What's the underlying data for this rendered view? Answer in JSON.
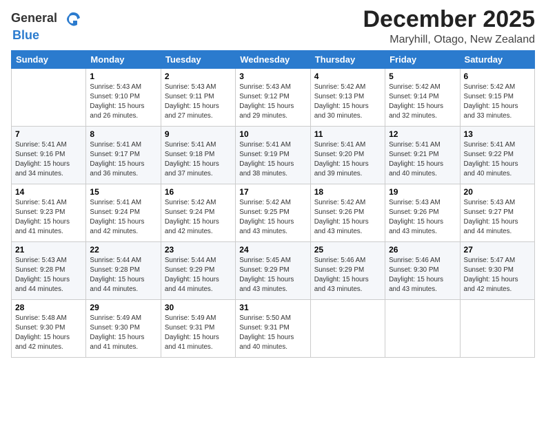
{
  "header": {
    "logo_general": "General",
    "logo_blue": "Blue",
    "month": "December 2025",
    "location": "Maryhill, Otago, New Zealand"
  },
  "weekdays": [
    "Sunday",
    "Monday",
    "Tuesday",
    "Wednesday",
    "Thursday",
    "Friday",
    "Saturday"
  ],
  "weeks": [
    [
      {
        "day": "",
        "info": ""
      },
      {
        "day": "1",
        "info": "Sunrise: 5:43 AM\nSunset: 9:10 PM\nDaylight: 15 hours\nand 26 minutes."
      },
      {
        "day": "2",
        "info": "Sunrise: 5:43 AM\nSunset: 9:11 PM\nDaylight: 15 hours\nand 27 minutes."
      },
      {
        "day": "3",
        "info": "Sunrise: 5:43 AM\nSunset: 9:12 PM\nDaylight: 15 hours\nand 29 minutes."
      },
      {
        "day": "4",
        "info": "Sunrise: 5:42 AM\nSunset: 9:13 PM\nDaylight: 15 hours\nand 30 minutes."
      },
      {
        "day": "5",
        "info": "Sunrise: 5:42 AM\nSunset: 9:14 PM\nDaylight: 15 hours\nand 32 minutes."
      },
      {
        "day": "6",
        "info": "Sunrise: 5:42 AM\nSunset: 9:15 PM\nDaylight: 15 hours\nand 33 minutes."
      }
    ],
    [
      {
        "day": "7",
        "info": "Sunrise: 5:41 AM\nSunset: 9:16 PM\nDaylight: 15 hours\nand 34 minutes."
      },
      {
        "day": "8",
        "info": "Sunrise: 5:41 AM\nSunset: 9:17 PM\nDaylight: 15 hours\nand 36 minutes."
      },
      {
        "day": "9",
        "info": "Sunrise: 5:41 AM\nSunset: 9:18 PM\nDaylight: 15 hours\nand 37 minutes."
      },
      {
        "day": "10",
        "info": "Sunrise: 5:41 AM\nSunset: 9:19 PM\nDaylight: 15 hours\nand 38 minutes."
      },
      {
        "day": "11",
        "info": "Sunrise: 5:41 AM\nSunset: 9:20 PM\nDaylight: 15 hours\nand 39 minutes."
      },
      {
        "day": "12",
        "info": "Sunrise: 5:41 AM\nSunset: 9:21 PM\nDaylight: 15 hours\nand 40 minutes."
      },
      {
        "day": "13",
        "info": "Sunrise: 5:41 AM\nSunset: 9:22 PM\nDaylight: 15 hours\nand 40 minutes."
      }
    ],
    [
      {
        "day": "14",
        "info": "Sunrise: 5:41 AM\nSunset: 9:23 PM\nDaylight: 15 hours\nand 41 minutes."
      },
      {
        "day": "15",
        "info": "Sunrise: 5:41 AM\nSunset: 9:24 PM\nDaylight: 15 hours\nand 42 minutes."
      },
      {
        "day": "16",
        "info": "Sunrise: 5:42 AM\nSunset: 9:24 PM\nDaylight: 15 hours\nand 42 minutes."
      },
      {
        "day": "17",
        "info": "Sunrise: 5:42 AM\nSunset: 9:25 PM\nDaylight: 15 hours\nand 43 minutes."
      },
      {
        "day": "18",
        "info": "Sunrise: 5:42 AM\nSunset: 9:26 PM\nDaylight: 15 hours\nand 43 minutes."
      },
      {
        "day": "19",
        "info": "Sunrise: 5:43 AM\nSunset: 9:26 PM\nDaylight: 15 hours\nand 43 minutes."
      },
      {
        "day": "20",
        "info": "Sunrise: 5:43 AM\nSunset: 9:27 PM\nDaylight: 15 hours\nand 44 minutes."
      }
    ],
    [
      {
        "day": "21",
        "info": "Sunrise: 5:43 AM\nSunset: 9:28 PM\nDaylight: 15 hours\nand 44 minutes."
      },
      {
        "day": "22",
        "info": "Sunrise: 5:44 AM\nSunset: 9:28 PM\nDaylight: 15 hours\nand 44 minutes."
      },
      {
        "day": "23",
        "info": "Sunrise: 5:44 AM\nSunset: 9:29 PM\nDaylight: 15 hours\nand 44 minutes."
      },
      {
        "day": "24",
        "info": "Sunrise: 5:45 AM\nSunset: 9:29 PM\nDaylight: 15 hours\nand 43 minutes."
      },
      {
        "day": "25",
        "info": "Sunrise: 5:46 AM\nSunset: 9:29 PM\nDaylight: 15 hours\nand 43 minutes."
      },
      {
        "day": "26",
        "info": "Sunrise: 5:46 AM\nSunset: 9:30 PM\nDaylight: 15 hours\nand 43 minutes."
      },
      {
        "day": "27",
        "info": "Sunrise: 5:47 AM\nSunset: 9:30 PM\nDaylight: 15 hours\nand 42 minutes."
      }
    ],
    [
      {
        "day": "28",
        "info": "Sunrise: 5:48 AM\nSunset: 9:30 PM\nDaylight: 15 hours\nand 42 minutes."
      },
      {
        "day": "29",
        "info": "Sunrise: 5:49 AM\nSunset: 9:30 PM\nDaylight: 15 hours\nand 41 minutes."
      },
      {
        "day": "30",
        "info": "Sunrise: 5:49 AM\nSunset: 9:31 PM\nDaylight: 15 hours\nand 41 minutes."
      },
      {
        "day": "31",
        "info": "Sunrise: 5:50 AM\nSunset: 9:31 PM\nDaylight: 15 hours\nand 40 minutes."
      },
      {
        "day": "",
        "info": ""
      },
      {
        "day": "",
        "info": ""
      },
      {
        "day": "",
        "info": ""
      }
    ]
  ]
}
